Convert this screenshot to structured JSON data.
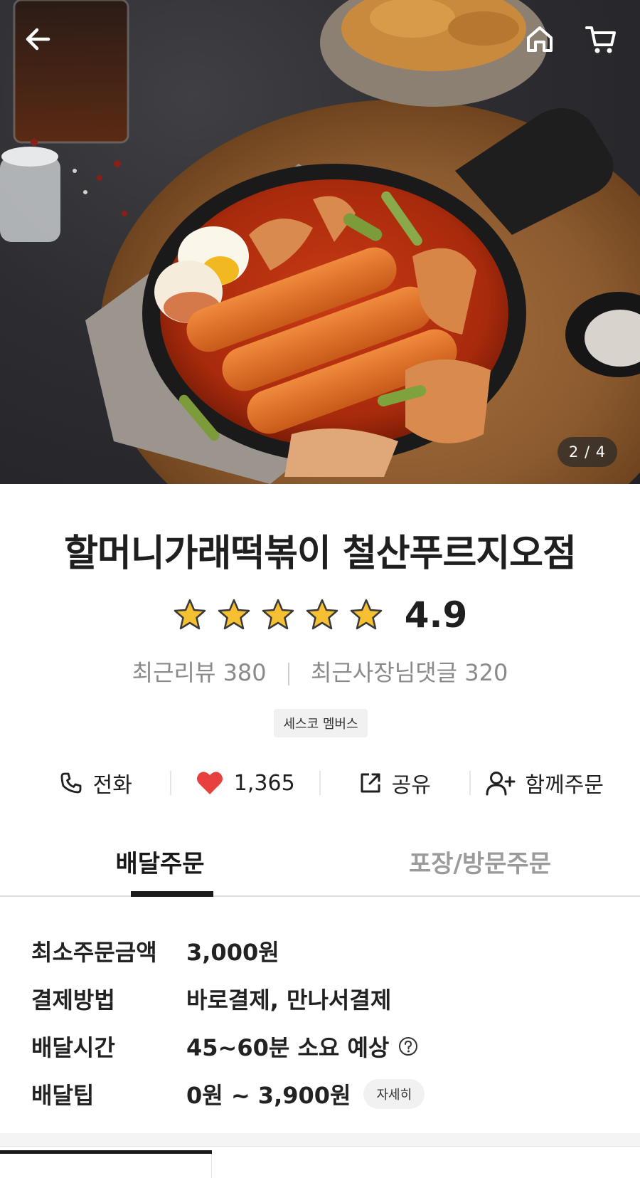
{
  "hero": {
    "page_indicator": "2 / 4",
    "icons": [
      "back-arrow-icon",
      "home-icon",
      "cart-icon"
    ]
  },
  "store": {
    "name": "할머니가래떡볶이 철산푸르지오점",
    "rating": "4.9",
    "stars": 5,
    "recent_reviews_label": "최근리뷰 380",
    "owner_replies_label": "최근사장님댓글 320",
    "badge": "세스코 멤버스"
  },
  "actions": {
    "call_label": "전화",
    "like_count": "1,365",
    "share_label": "공유",
    "group_order_label": "함께주문"
  },
  "tabs": {
    "delivery": "배달주문",
    "pickup": "포장/방문주문"
  },
  "info": {
    "min_order_label": "최소주문금액",
    "min_order_value": "3,000원",
    "payment_label": "결제방법",
    "payment_value": "바로결제, 만나서결제",
    "delivery_time_label": "배달시간",
    "delivery_time_value": "45~60분 소요 예상",
    "delivery_tip_label": "배달팁",
    "delivery_tip_value": "0원 ~ 3,900원",
    "detail_button": "자세히"
  },
  "colors": {
    "heart": "#e8403f",
    "star": "#f6c033",
    "text": "#1f1f1f",
    "muted": "#8a8a8a"
  }
}
